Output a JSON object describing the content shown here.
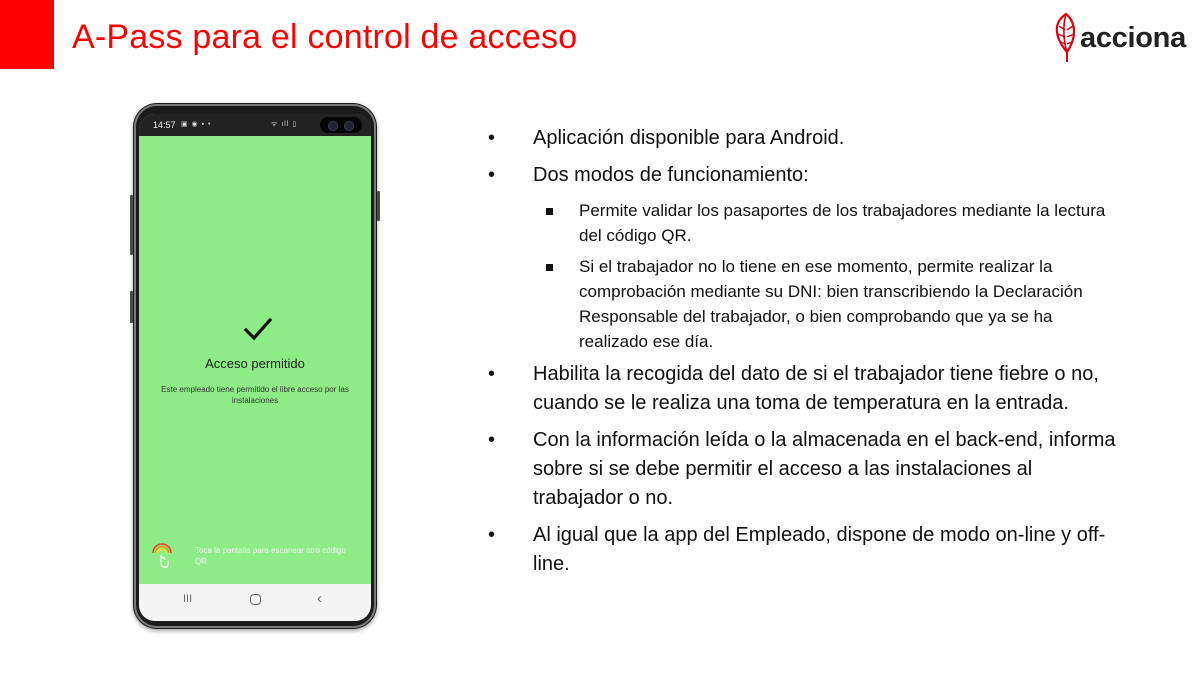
{
  "slide": {
    "title": "A-Pass para el control de acceso",
    "brand_color": "#ff0000"
  },
  "logo": {
    "text": "acciona",
    "icon": "acciona-leaf-logo"
  },
  "phone": {
    "status_time": "14:57",
    "status_icons_left": "▣ ◉ ▪ •",
    "status_icons_right": "ᯤ ıll ▯",
    "screen_color": "#8eec87",
    "access_title": "Acceso permitido",
    "access_description": "Este empleado tiene permitido el libre acceso por las instalaciones",
    "scan_hint": "Toca la pantalla para escanear otro código QR",
    "nav_recent": "III",
    "nav_back": "‹"
  },
  "bullets": [
    {
      "level": 1,
      "text": "Aplicación disponible para Android."
    },
    {
      "level": 1,
      "text": "Dos modos de funcionamiento:"
    },
    {
      "level": 2,
      "text": "Permite validar los pasaportes de los trabajadores mediante la lectura del código QR."
    },
    {
      "level": 2,
      "text": "Si el trabajador no lo tiene en ese momento, permite realizar la comprobación mediante su DNI: bien transcribiendo la Declaración Responsable del trabajador, o bien comprobando que ya se ha realizado ese día."
    },
    {
      "level": 1,
      "text": "Habilita la recogida del dato de si el trabajador tiene fiebre o no, cuando se le realiza una toma de temperatura en la entrada."
    },
    {
      "level": 1,
      "text": "Con la información leída o la almacenada en el back-end, informa sobre si se debe permitir el acceso a las instalaciones al trabajador o no."
    },
    {
      "level": 1,
      "text": "Al igual que la app del Empleado, dispone de modo on-line y off-line."
    }
  ]
}
